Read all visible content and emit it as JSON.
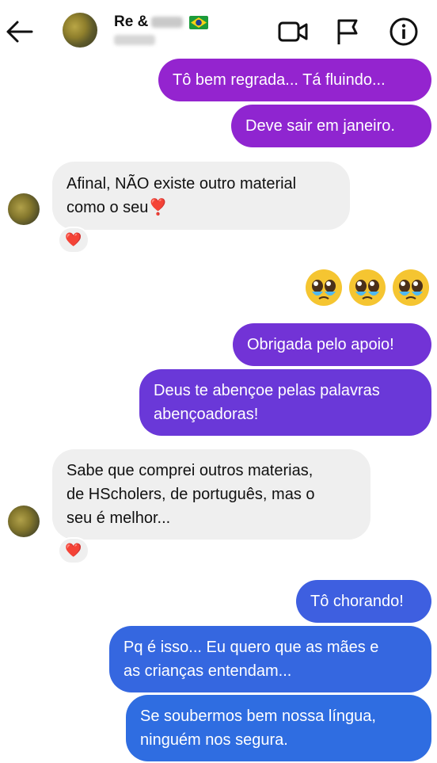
{
  "header": {
    "title": "Re &",
    "flag": "Brazil",
    "icons": [
      "back-arrow-icon",
      "video-camera-icon",
      "flag-icon",
      "info-icon"
    ]
  },
  "messages": [
    {
      "side": "sent",
      "text": "Tô bem regrada... Tá fluindo..."
    },
    {
      "side": "sent",
      "text": "Deve sair em janeiro."
    },
    {
      "side": "received",
      "lines": [
        "Afinal, NÃO existe outro material",
        "como o seu❣️"
      ],
      "reaction": "heart"
    },
    {
      "side": "sent",
      "emoji": "pleading-face x3"
    },
    {
      "side": "sent",
      "text": "Obrigada pelo apoio!"
    },
    {
      "side": "sent",
      "lines": [
        "Deus te abençoe pelas palavras",
        "abençoadoras!"
      ]
    },
    {
      "side": "received",
      "lines": [
        "Sabe que comprei outros materias,",
        "de HScholers, de português, mas o",
        "seu é melhor..."
      ],
      "reaction": "heart"
    },
    {
      "side": "sent",
      "text": "Tô chorando!"
    },
    {
      "side": "sent",
      "lines": [
        "Pq é isso... Eu quero que as mães e",
        "as crianças entendam..."
      ]
    },
    {
      "side": "sent",
      "lines": [
        "Se soubermos bem nossa língua,",
        "ninguém nos segura."
      ]
    }
  ],
  "reaction_symbol": "❤️",
  "colors": {
    "received_bubble": "#efefef",
    "gradient_top": "#8e1ed2",
    "gradient_mid": "#6a34d8",
    "gradient_bottom": "#2f6be0"
  }
}
